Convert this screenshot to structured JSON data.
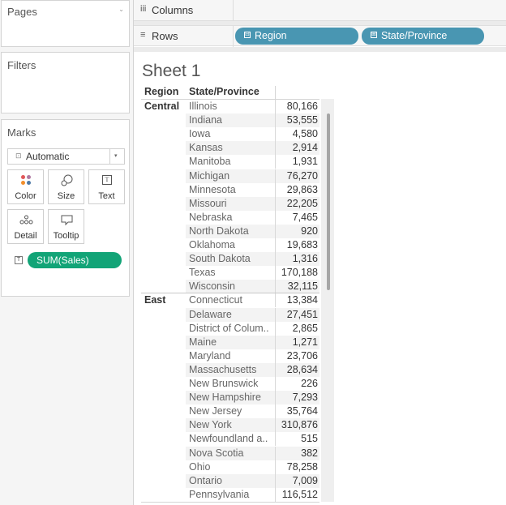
{
  "left_pane": {
    "pages_title": "Pages",
    "pages_caret": "⌄",
    "filters_title": "Filters",
    "marks_title": "Marks",
    "mark_type": {
      "icon": "⊡",
      "label": "Automatic",
      "caret": "▾"
    },
    "mark_buttons": {
      "color": "Color",
      "size": "Size",
      "text": "Text",
      "text_icon_glyph": "T",
      "detail": "Detail",
      "tooltip": "Tooltip"
    },
    "measure_pill": {
      "icon": "T",
      "label": "SUM(Sales)",
      "color": "#12a477"
    }
  },
  "shelves": {
    "columns_icon": "iii",
    "columns_label": "Columns",
    "rows_icon": "≡",
    "rows_label": "Rows",
    "row_pills": [
      {
        "icon": "⊟",
        "label": "Region"
      },
      {
        "icon": "⊞",
        "label": "State/Province"
      }
    ],
    "pill_color": "#4996b2"
  },
  "sheet": {
    "title": "Sheet 1",
    "headers": {
      "region": "Region",
      "state": "State/Province"
    },
    "groups": [
      {
        "region": "Central",
        "rows": [
          {
            "state": "Illinois",
            "value": "80,166"
          },
          {
            "state": "Indiana",
            "value": "53,555"
          },
          {
            "state": "Iowa",
            "value": "4,580"
          },
          {
            "state": "Kansas",
            "value": "2,914"
          },
          {
            "state": "Manitoba",
            "value": "1,931"
          },
          {
            "state": "Michigan",
            "value": "76,270"
          },
          {
            "state": "Minnesota",
            "value": "29,863"
          },
          {
            "state": "Missouri",
            "value": "22,205"
          },
          {
            "state": "Nebraska",
            "value": "7,465"
          },
          {
            "state": "North Dakota",
            "value": "920"
          },
          {
            "state": "Oklahoma",
            "value": "19,683"
          },
          {
            "state": "South Dakota",
            "value": "1,316"
          },
          {
            "state": "Texas",
            "value": "170,188"
          },
          {
            "state": "Wisconsin",
            "value": "32,115"
          }
        ]
      },
      {
        "region": "East",
        "rows": [
          {
            "state": "Connecticut",
            "value": "13,384"
          },
          {
            "state": "Delaware",
            "value": "27,451"
          },
          {
            "state": "District of Colum..",
            "value": "2,865"
          },
          {
            "state": "Maine",
            "value": "1,271"
          },
          {
            "state": "Maryland",
            "value": "23,706"
          },
          {
            "state": "Massachusetts",
            "value": "28,634"
          },
          {
            "state": "New Brunswick",
            "value": "226"
          },
          {
            "state": "New Hampshire",
            "value": "7,293"
          },
          {
            "state": "New Jersey",
            "value": "35,764"
          },
          {
            "state": "New York",
            "value": "310,876"
          },
          {
            "state": "Newfoundland a..",
            "value": "515"
          },
          {
            "state": "Nova Scotia",
            "value": "382"
          },
          {
            "state": "Ohio",
            "value": "78,258"
          },
          {
            "state": "Ontario",
            "value": "7,009"
          },
          {
            "state": "Pennsylvania",
            "value": "116,512"
          }
        ]
      }
    ]
  }
}
